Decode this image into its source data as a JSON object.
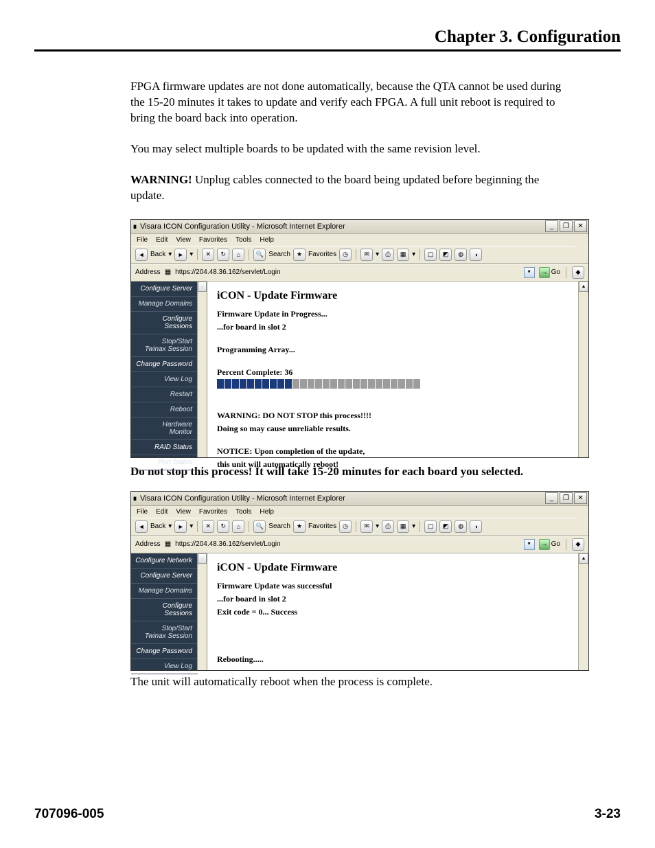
{
  "header": {
    "title": "Chapter 3.  Configuration"
  },
  "para1": "FPGA firmware updates are not done automatically, because the QTA cannot be used during the 15-20 minutes it takes to update and verify each FPGA. A full unit reboot is required to bring the board back into operation.",
  "para2": "You may select multiple boards to be updated with the same revision level.",
  "para3_lead": "WARNING!",
  "para3_rest": " Unplug cables connected to the board being updated before beginning the update.",
  "caption1": "Do not stop this process! It will take 15-20 minutes for each board you selected.",
  "caption2": "The unit will automatically reboot when the process is complete.",
  "footer": {
    "left": "707096-005",
    "right": "3-23"
  },
  "ie": {
    "title": "Visara ICON Configuration Utility - Microsoft Internet Explorer",
    "menu": {
      "file": "File",
      "edit": "Edit",
      "view": "View",
      "favorites": "Favorites",
      "tools": "Tools",
      "help": "Help"
    },
    "toolbar": {
      "back": "Back",
      "search": "Search",
      "favorites": "Favorites"
    },
    "addr_label": "Address",
    "addr_url": "https://204.48.36.162/servlet/Login",
    "go": "Go"
  },
  "shot1": {
    "side": {
      "i1": "Configure Server",
      "i2": "Manage Domains",
      "i3": "Configure Sessions",
      "i4a": "Stop/Start",
      "i4b": "Twinax Session",
      "i5": "Change Password",
      "i6": "View Log",
      "i7": "Restart",
      "i8": "Reboot",
      "i9a": "Hardware",
      "i9b": "Monitor",
      "i10": "RAID Status",
      "i11": "Port Status"
    },
    "title": "iCON - Update Firmware",
    "l1": "Firmware Update in Progress...",
    "l2": "...for board in slot 2",
    "l3": "Programming Array...",
    "l4": "Percent Complete: 36",
    "w1": "WARNING: DO NOT STOP this process!!!!",
    "w2": "Doing so may cause unreliable results.",
    "n1": "NOTICE: Upon completion of the update,",
    "n2": "this unit will automatically reboot!"
  },
  "shot2": {
    "side": {
      "i0": "Configure Network",
      "i1": "Configure Server",
      "i2": "Manage Domains",
      "i3": "Configure Sessions",
      "i4a": "Stop/Start",
      "i4b": "Twinax Session",
      "i5": "Change Password",
      "i6": "View Log"
    },
    "title": "iCON - Update Firmware",
    "l1": "Firmware Update was successful",
    "l2": "...for board in slot 2",
    "l3": "Exit code = 0... Success",
    "r": "Rebooting....."
  }
}
